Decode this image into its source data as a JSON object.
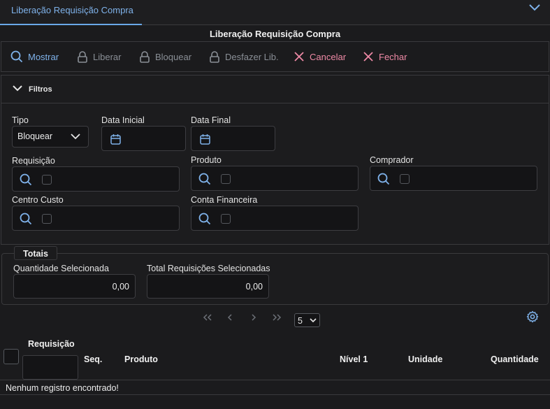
{
  "tab": {
    "label": "Liberação Requisição Compra"
  },
  "window": {
    "title": "Liberação Requisição Compra"
  },
  "toolbar": {
    "mostrar": "Mostrar",
    "liberar": "Liberar",
    "bloquear": "Bloquear",
    "desfazer": "Desfazer Lib.",
    "cancelar": "Cancelar",
    "fechar": "Fechar"
  },
  "filters": {
    "title": "Filtros",
    "tipo_label": "Tipo",
    "tipo_value": "Bloquear",
    "data_inicial_label": "Data Inicial",
    "data_final_label": "Data Final",
    "requisicao_label": "Requisição",
    "produto_label": "Produto",
    "comprador_label": "Comprador",
    "centro_custo_label": "Centro Custo",
    "conta_financeira_label": "Conta Financeira"
  },
  "totais": {
    "title": "Totais",
    "qtd_label": "Quantidade Selecionada",
    "qtd_value": "0,00",
    "total_label": "Total Requisições Selecionadas",
    "total_value": "0,00"
  },
  "pager": {
    "page_size": "5"
  },
  "grid": {
    "columns": {
      "requisicao": "Requisição",
      "seq": "Seq.",
      "produto": "Produto",
      "nivel": "Nível 1",
      "unidade": "Unidade",
      "quantidade": "Quantidade"
    },
    "empty_message": "Nenhum registro encontrado!"
  },
  "colors": {
    "accent": "#7fb2ea",
    "danger": "#ef8aa6",
    "disabled": "#8a8f96"
  }
}
